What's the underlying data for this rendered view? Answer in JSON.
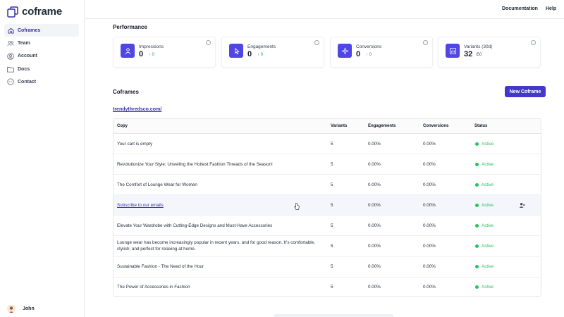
{
  "app": {
    "brand": "coframe"
  },
  "topbar": {
    "links": [
      "Documentation",
      "Help"
    ]
  },
  "sidebar": {
    "items": [
      {
        "label": "Coframes",
        "icon": "home-icon",
        "active": true
      },
      {
        "label": "Team",
        "icon": "team-icon",
        "active": false
      },
      {
        "label": "Account",
        "icon": "account-icon",
        "active": false
      },
      {
        "label": "Docs",
        "icon": "folder-icon",
        "active": false
      },
      {
        "label": "Contact",
        "icon": "chat-icon",
        "active": false
      }
    ],
    "user": {
      "name": "John"
    }
  },
  "performance": {
    "title": "Performance",
    "stats": [
      {
        "label": "Impressions",
        "value": "0",
        "delta": "0",
        "icon": "users-icon"
      },
      {
        "label": "Engagements",
        "value": "0",
        "delta": "0",
        "icon": "pointer-icon"
      },
      {
        "label": "Conversions",
        "value": "0",
        "delta": "0",
        "icon": "sparkle-icon"
      },
      {
        "label": "Variants (30d)",
        "value": "32",
        "sub": "/50",
        "icon": "bar-chart-icon"
      }
    ]
  },
  "coframes": {
    "title": "Coframes",
    "new_button": "New Coframe",
    "site": "trendythredsco.com/",
    "columns": [
      "Copy",
      "Variants",
      "Engagements",
      "Conversions",
      "Status"
    ],
    "rows": [
      {
        "copy": "Your cart is empty",
        "variants": "5",
        "engagements": "0.00%",
        "conversions": "0.00%",
        "status": "Active"
      },
      {
        "copy": "Revolutionize Your Style: Unveiling the Hottest Fashion Threads of the Season!",
        "variants": "5",
        "engagements": "0.00%",
        "conversions": "0.00%",
        "status": "Active"
      },
      {
        "copy": "The Comfort of Lounge Wear for Women",
        "variants": "5",
        "engagements": "0.00%",
        "conversions": "0.00%",
        "status": "Active"
      },
      {
        "copy": "Subscribe to our emails",
        "variants": "5",
        "engagements": "0.00%",
        "conversions": "0.00%",
        "status": "Active"
      },
      {
        "copy": "Elevate Your Wardrobe with Cutting-Edge Designs and Must-Have Accessories",
        "variants": "5",
        "engagements": "0.00%",
        "conversions": "0.00%",
        "status": "Active"
      },
      {
        "copy": "Lounge wear has become increasingly popular in recent years, and for good reason. It's comfortable, stylish, and perfect for relaxing at home.",
        "variants": "5",
        "engagements": "0.00%",
        "conversions": "0.00%",
        "status": "Active"
      },
      {
        "copy": "Sustainable Fashion - The Need of the Hour",
        "variants": "5",
        "engagements": "0.00%",
        "conversions": "0.00%",
        "status": "Active"
      },
      {
        "copy": "The Power of Accessories in Fashion",
        "variants": "5",
        "engagements": "0.00%",
        "conversions": "0.00%",
        "status": "Active"
      }
    ]
  },
  "colors": {
    "accent": "#4f46e5",
    "button": "#4338ca",
    "active": "#22c55e",
    "link": "#3730a3"
  }
}
